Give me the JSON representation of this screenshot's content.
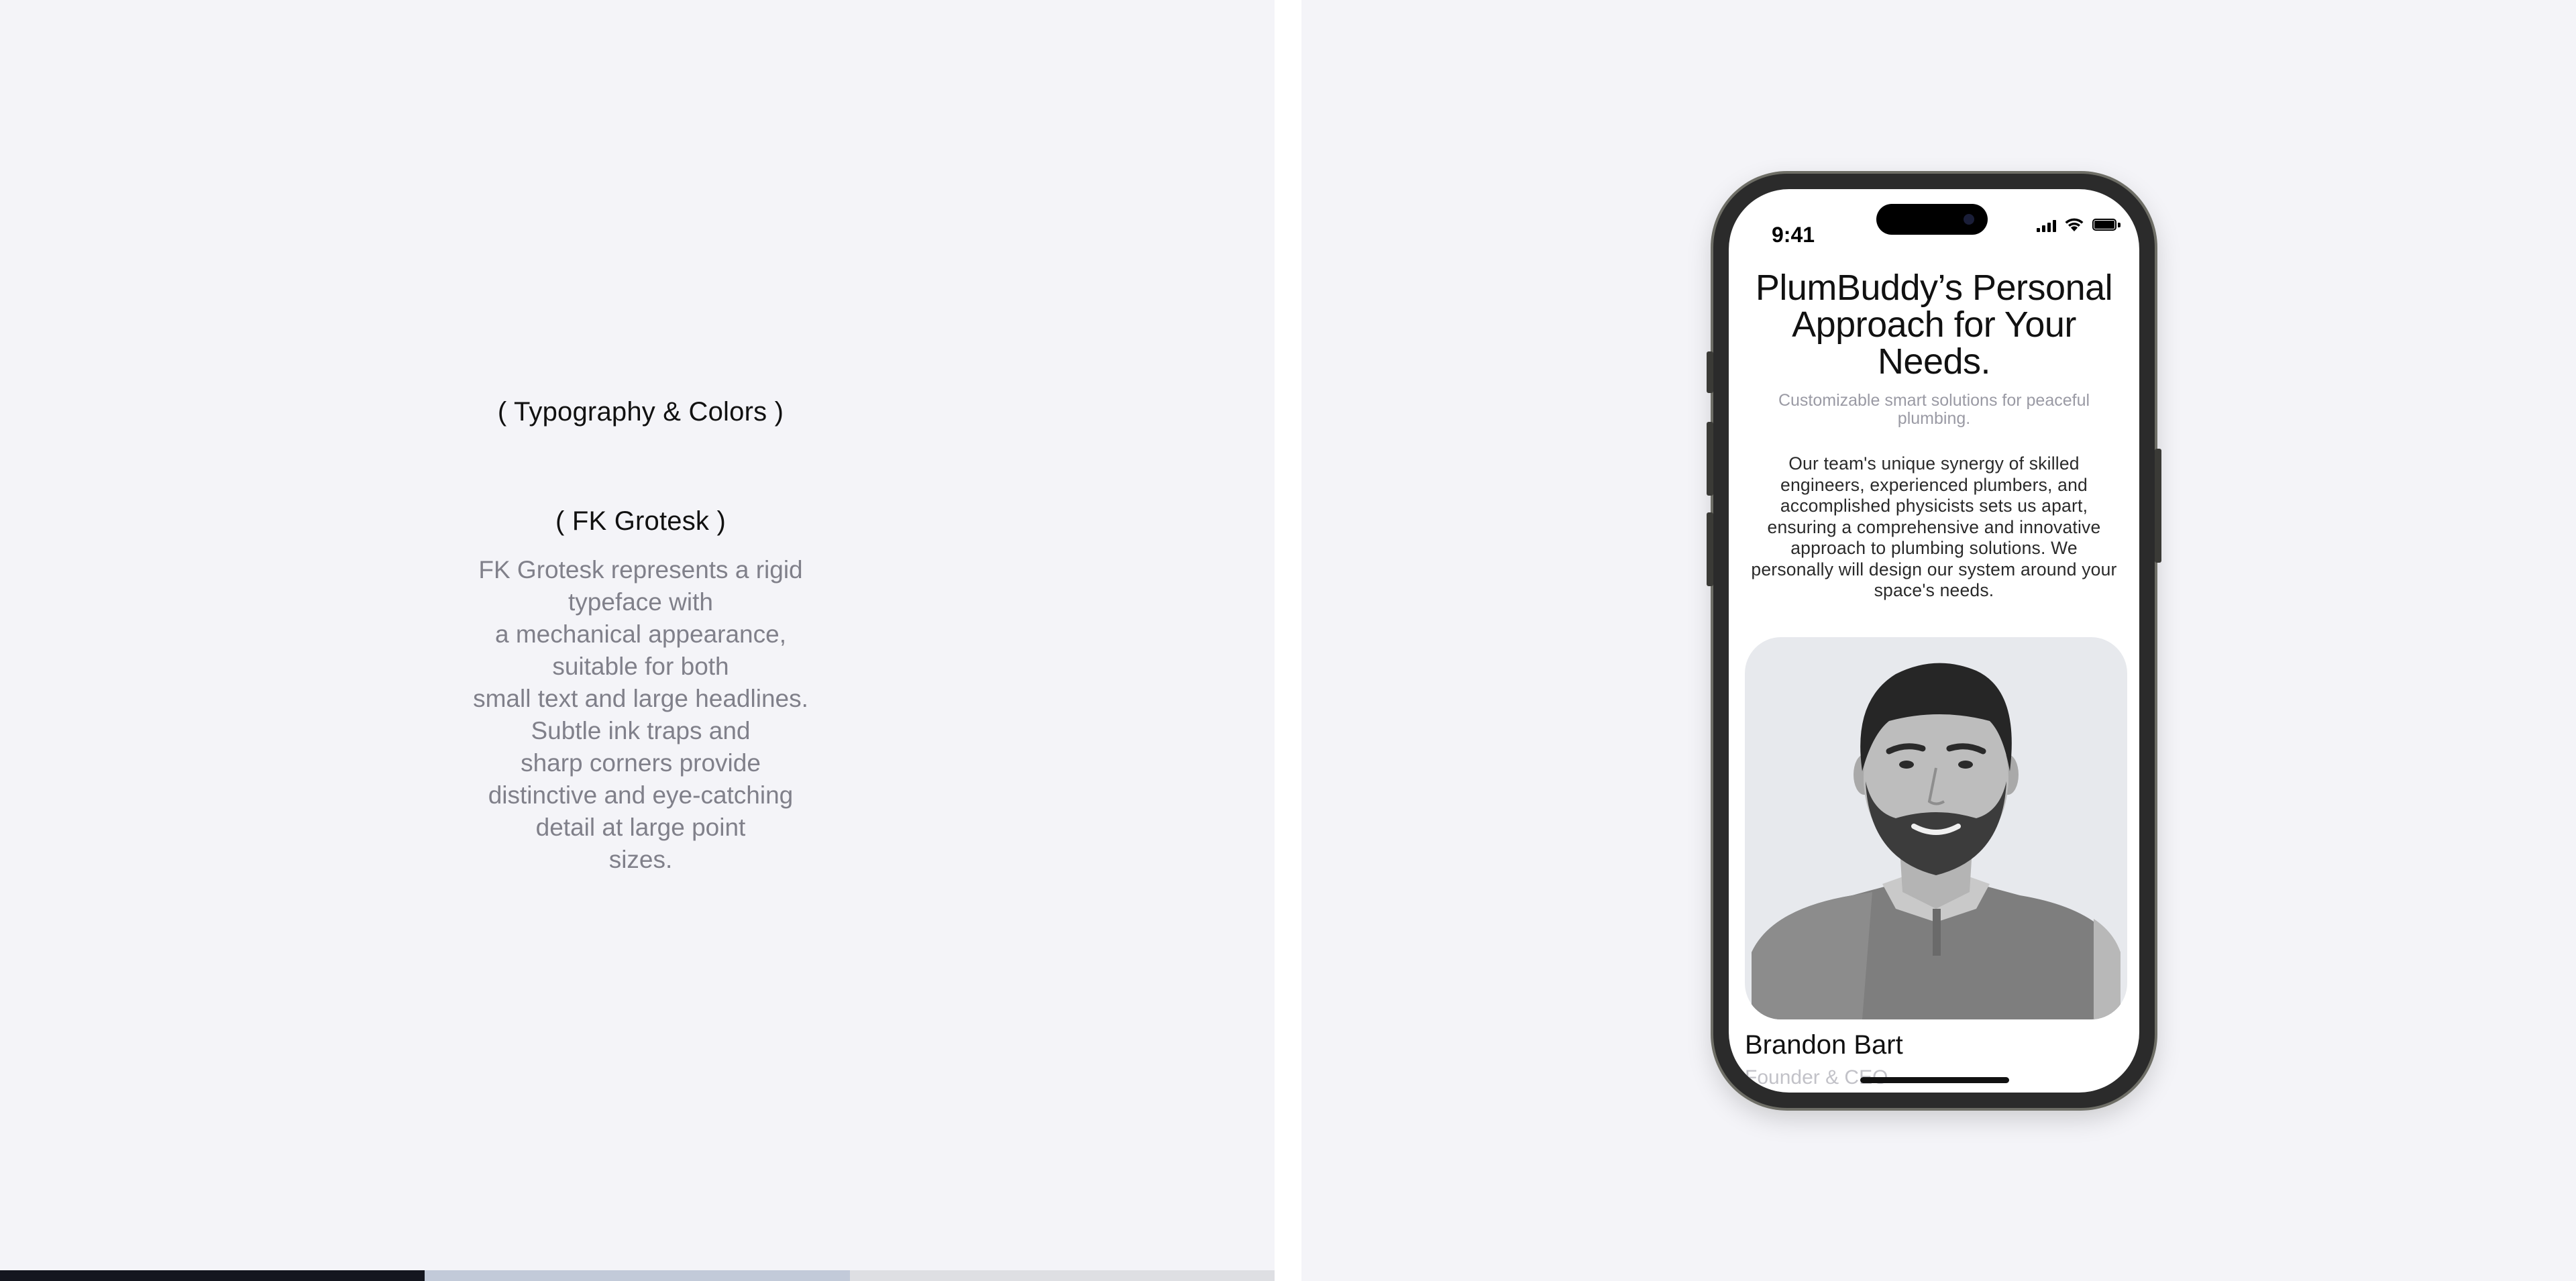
{
  "left": {
    "section_title": "( Typography & Colors )",
    "font_name": "( FK Grotesk )",
    "font_description_lines": [
      "FK Grotesk represents a rigid",
      "typeface with",
      "a mechanical appearance,",
      "suitable for both",
      "small text and large headlines.",
      "Subtle ink traps and",
      "sharp corners provide",
      "distinctive and eye-catching",
      "detail at large point",
      "sizes."
    ],
    "palette": [
      "#14161f",
      "#c2cad9",
      "#dedfe3"
    ]
  },
  "phone": {
    "status": {
      "time": "9:41",
      "icons": [
        "signal-icon",
        "wifi-icon",
        "battery-icon"
      ]
    },
    "title": "PlumBuddy’s Personal Approach for Your Needs.",
    "subtitle": "Customizable smart solutions for peaceful plumbing.",
    "body": "Our team's unique synergy of skilled engineers, experienced plumbers, and accomplished physicists sets us apart, ensuring a comprehensive and innovative approach to plumbing solutions. We personally will design our system around your space's needs.",
    "person": {
      "name": "Brandon Bart",
      "role": "Founder & CEO"
    }
  }
}
